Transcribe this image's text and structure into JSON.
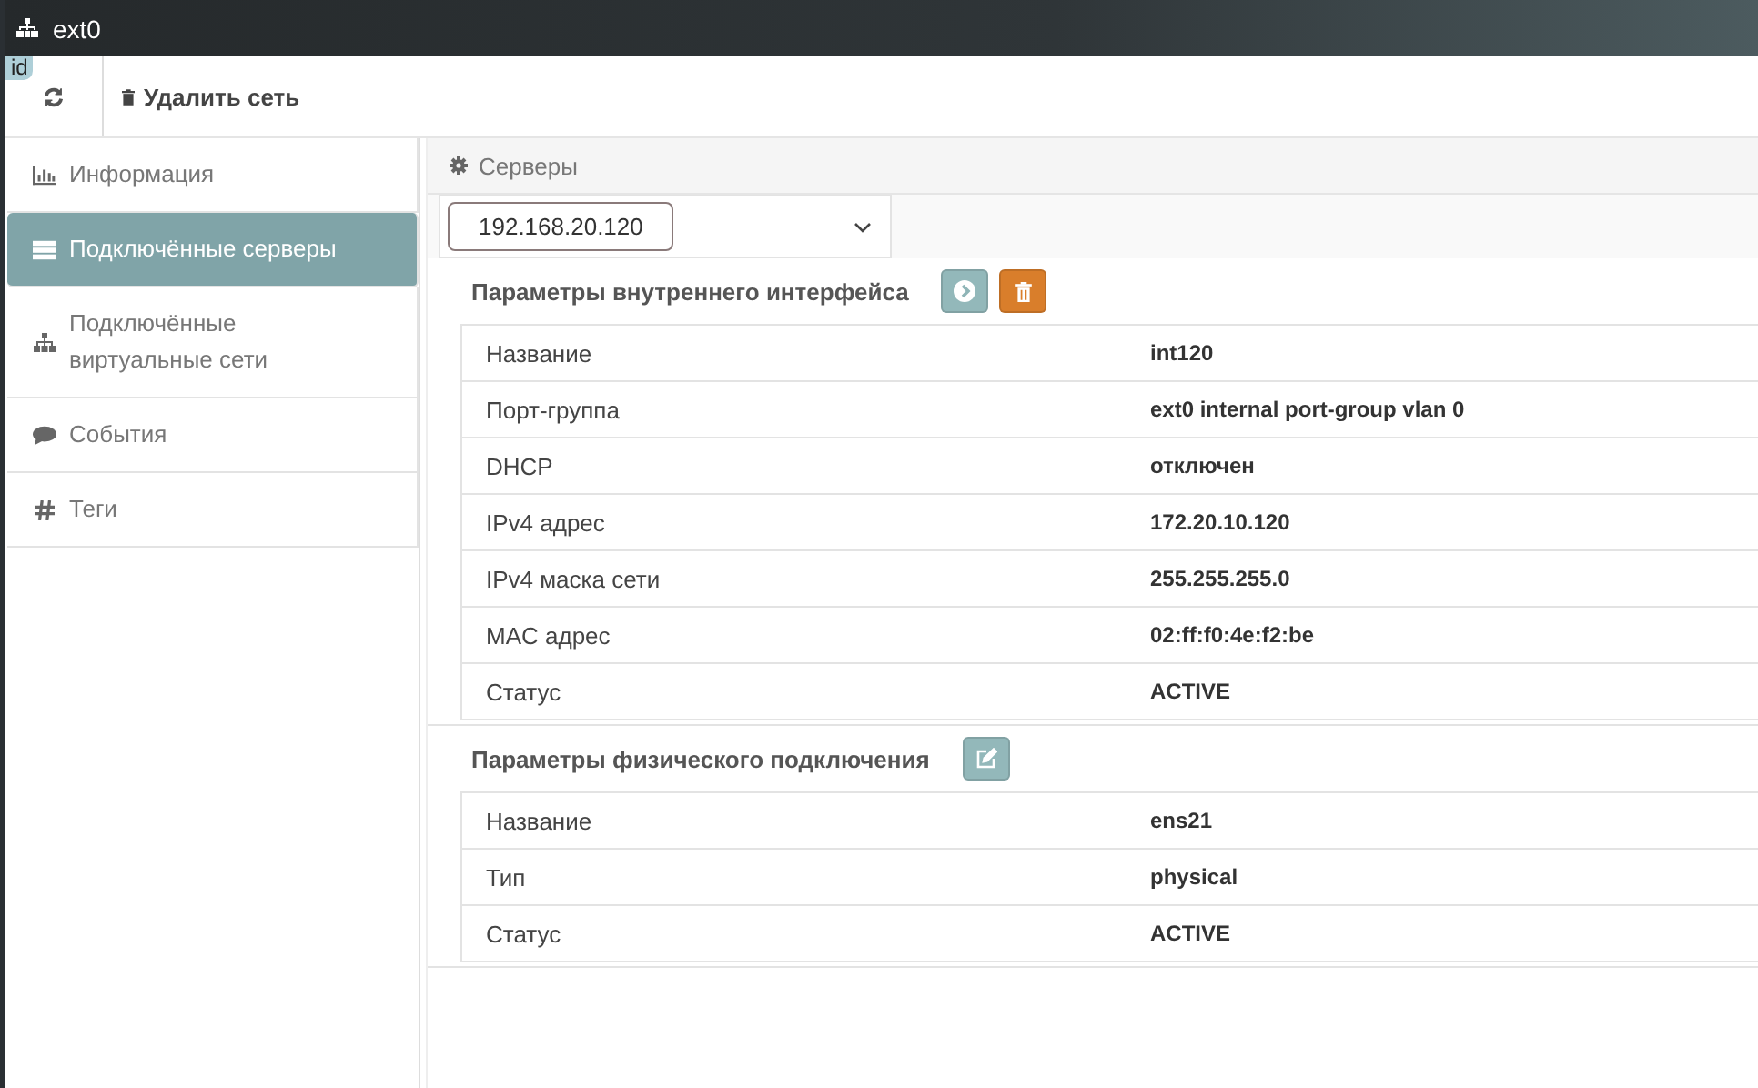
{
  "window": {
    "title": "ext0",
    "badge": "id"
  },
  "toolbar": {
    "delete_label": "Удалить сеть"
  },
  "sidebar": {
    "items": [
      {
        "label": "Информация",
        "selected": false
      },
      {
        "label": "Подключённые серверы",
        "selected": true
      },
      {
        "label": "Подключённые виртуальные сети",
        "selected": false
      },
      {
        "label": "События",
        "selected": false
      },
      {
        "label": "Теги",
        "selected": false
      }
    ]
  },
  "panel": {
    "title": "Серверы",
    "server_select": {
      "value": "192.168.20.120"
    }
  },
  "sections": [
    {
      "title": "Параметры внутреннего интерфейса",
      "buttons": [
        {
          "kind": "go"
        },
        {
          "kind": "delete"
        }
      ],
      "rows": [
        {
          "label": "Название",
          "value": "int120"
        },
        {
          "label": "Порт-группа",
          "value": "ext0 internal port-group vlan 0"
        },
        {
          "label": "DHCP",
          "value": "отключен"
        },
        {
          "label": "IPv4 адрес",
          "value": "172.20.10.120"
        },
        {
          "label": "IPv4 маска сети",
          "value": "255.255.255.0"
        },
        {
          "label": "MAC адрес",
          "value": "02:ff:f0:4e:f2:be"
        },
        {
          "label": "Статус",
          "value": "ACTIVE"
        }
      ]
    },
    {
      "title": "Параметры физического подключения",
      "buttons": [
        {
          "kind": "edit"
        }
      ],
      "rows": [
        {
          "label": "Название",
          "value": "ens21"
        },
        {
          "label": "Тип",
          "value": "physical"
        },
        {
          "label": "Статус",
          "value": "ACTIVE"
        }
      ]
    }
  ]
}
